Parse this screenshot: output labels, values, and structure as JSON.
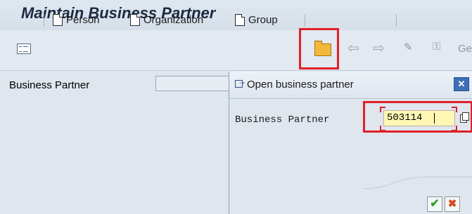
{
  "header": {
    "title": "Maintain Business Partner"
  },
  "toolbar": {
    "person_label": "Person",
    "organization_label": "Organization",
    "group_label": "Group",
    "truncated_label": "Ge"
  },
  "main": {
    "business_partner_label": "Business Partner",
    "business_partner_value": ""
  },
  "dialog": {
    "title": "Open business partner",
    "field_label": "Business Partner",
    "field_value": "503114"
  },
  "colors": {
    "highlight": "#e0202a",
    "accent": "#3e6fb6",
    "input_bg": "#fff8b5"
  },
  "icons": [
    "list-icon",
    "person-document-icon",
    "organization-document-icon",
    "group-document-icon",
    "open-folder-icon",
    "back-arrow-icon",
    "forward-arrow-icon",
    "display-change-icon",
    "other-icon",
    "open-dialog-icon",
    "close-icon",
    "copy-icon",
    "check-icon",
    "cancel-icon"
  ]
}
